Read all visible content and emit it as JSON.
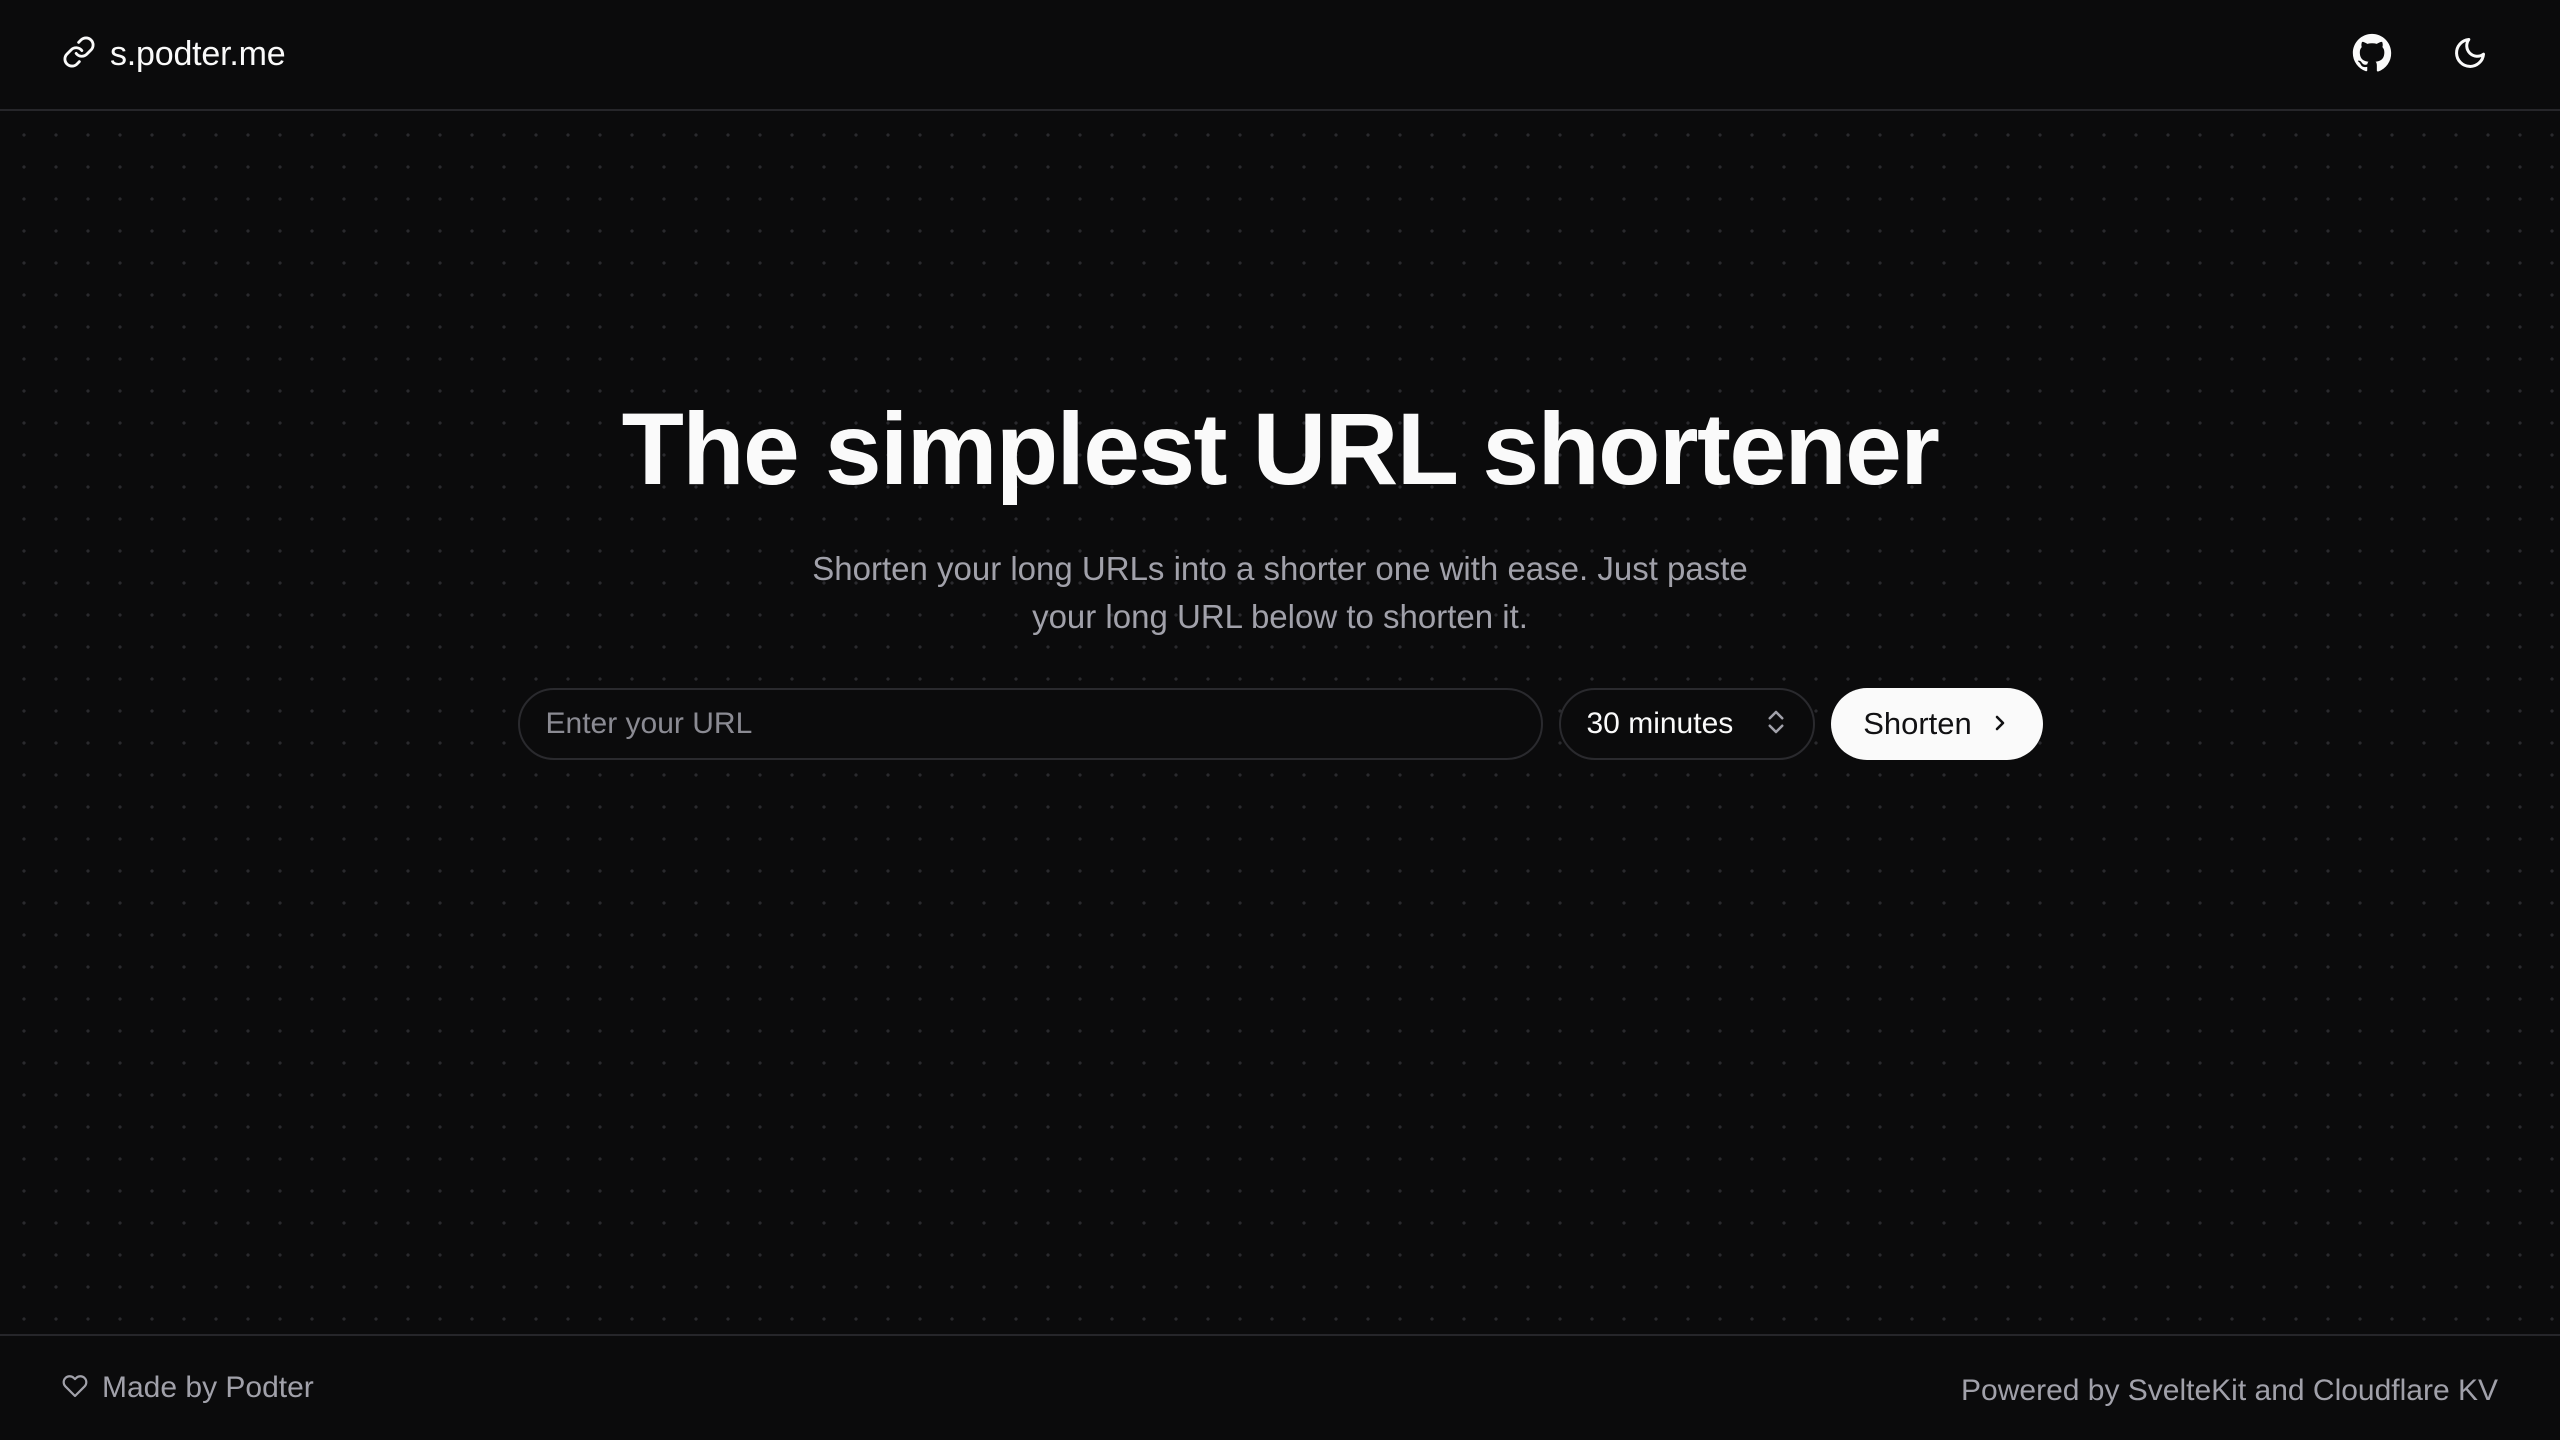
{
  "header": {
    "brand": "s.podter.me",
    "brand_icon": "link-icon",
    "actions": [
      {
        "name": "github-icon"
      },
      {
        "name": "moon-icon"
      }
    ]
  },
  "hero": {
    "title": "The simplest URL shortener",
    "subtitle": "Shorten your long URLs into a shorter one with ease. Just paste your long URL below to shorten it."
  },
  "form": {
    "url_placeholder": "Enter your URL",
    "url_value": "",
    "duration_selected": "30 minutes",
    "submit_label": "Shorten"
  },
  "footer": {
    "made_by": "Made by Podter",
    "powered_by": "Powered by SvelteKit and Cloudflare KV"
  },
  "colors": {
    "background": "#0b0b0c",
    "foreground": "#fafafa",
    "muted": "#a1a1aa",
    "border": "#26262a"
  }
}
